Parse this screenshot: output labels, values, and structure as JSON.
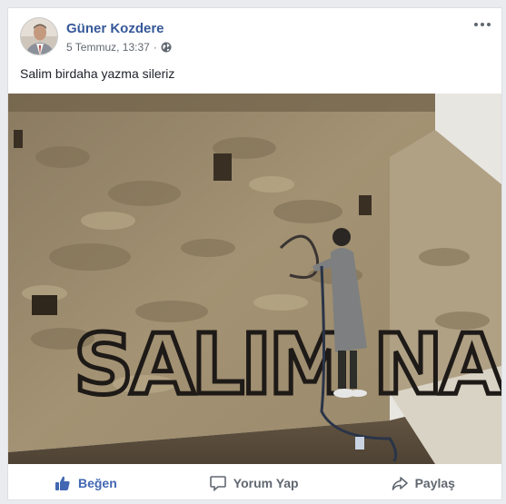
{
  "post": {
    "author_name": "Güner Kozdere",
    "timestamp": "5 Temmuz, 13:37",
    "separator": "·",
    "audience_icon": "globe-icon",
    "text": "Salim birdaha yazma sileriz",
    "more_icon": "more-options-icon"
  },
  "photo": {
    "graffiti_text": "SALIM NA"
  },
  "actions": {
    "like_label": "Beğen",
    "comment_label": "Yorum Yap",
    "share_label": "Paylaş",
    "like_icon": "thumbs-up-icon",
    "comment_icon": "comment-icon",
    "share_icon": "share-icon"
  },
  "colors": {
    "link_blue": "#365899",
    "like_blue": "#4267b2",
    "muted_text": "#606770",
    "page_bg": "#e9ebee"
  }
}
